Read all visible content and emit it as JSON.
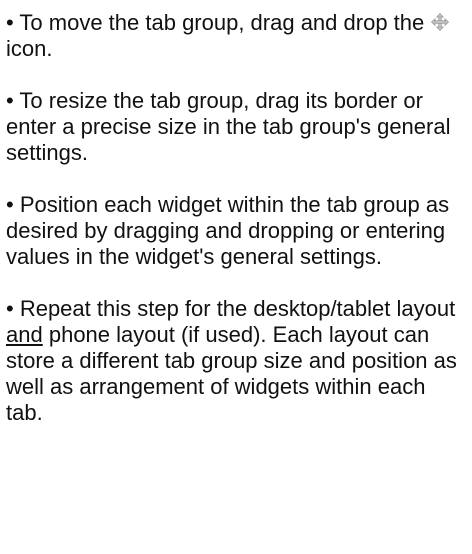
{
  "instructions": {
    "move": {
      "before_icon": "• To move the tab group, drag and drop the",
      "icon": "move-arrows-icon",
      "after_icon": "icon."
    },
    "resize": {
      "text": "• To resize the tab group, drag its border or enter a precise size in the tab group's general settings."
    },
    "position": {
      "text": "• Position each widget within the tab group as desired by dragging and dropping or entering values in the widget's general settings."
    },
    "repeat": {
      "before_and": "• Repeat this step for the desktop/tablet layout",
      "and": "and",
      "after_and": "phone layout (if used). Each layout can store a different tab group size and position as well as arrangement of widgets within each tab."
    }
  },
  "colors": {
    "text": "#111111",
    "icon_fill": "#c9c9c9",
    "icon_stroke": "#9a9a9a"
  }
}
